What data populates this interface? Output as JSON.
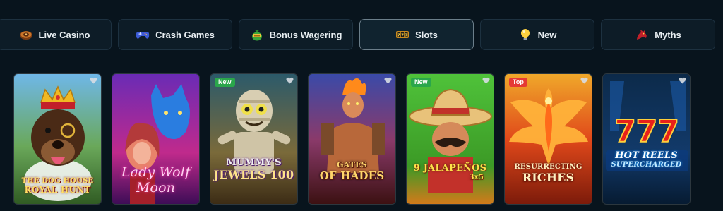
{
  "tabs": [
    {
      "label": "Live Casino",
      "icon": "roulette-icon",
      "active": false
    },
    {
      "label": "Crash Games",
      "icon": "gamepad-icon",
      "active": false
    },
    {
      "label": "Bonus Wagering",
      "icon": "money-bag-icon",
      "active": false
    },
    {
      "label": "Slots",
      "icon": "slot-machine-icon",
      "active": true
    },
    {
      "label": "New",
      "icon": "lightbulb-icon",
      "active": false
    },
    {
      "label": "Myths",
      "icon": "dragon-icon",
      "active": false
    }
  ],
  "games": [
    {
      "title_line1": "THE DOG HOUSE",
      "title_line2": "ROYAL HUNT",
      "badge": ""
    },
    {
      "title_line1": "Lady Wolf",
      "title_line2": "Moon",
      "badge": ""
    },
    {
      "title_line1": "MUMMY'S",
      "title_line2": "JEWELS 100",
      "badge": "New"
    },
    {
      "title_line1": "GATES",
      "title_line2": "OF HADES",
      "badge": ""
    },
    {
      "title_line1": "9 JALAPEÑOS",
      "title_line2": "3x5",
      "badge": "New"
    },
    {
      "title_line1": "RESURRECTING",
      "title_line2": "RICHES",
      "badge": "Top"
    },
    {
      "title_line1": "HOT REELS",
      "title_line2": "SUPERCHARGED",
      "badge": ""
    }
  ],
  "colors": {
    "background": "#08141d",
    "tab_bg": "#0d1c27",
    "tab_border": "#1d3140",
    "active_border": "#6b7e8a",
    "badge_new": "#2aa64b",
    "badge_top": "#e53935"
  }
}
